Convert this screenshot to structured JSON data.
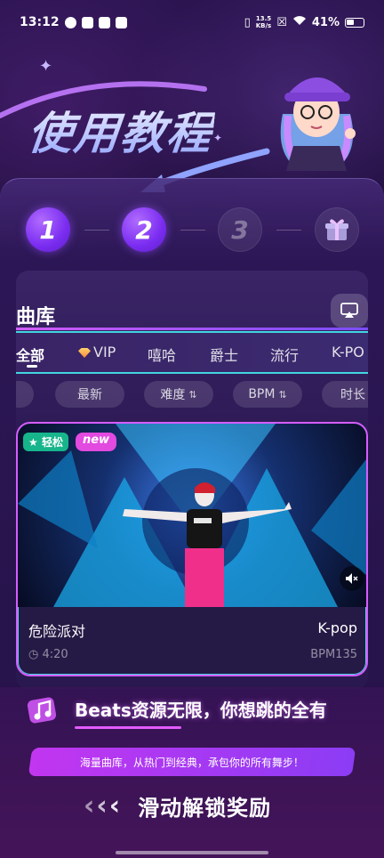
{
  "status_bar": {
    "time": "13:12",
    "net_speed_value": "13.5",
    "net_speed_unit": "KB/s",
    "battery": "41%"
  },
  "header": {
    "title": "使用教程"
  },
  "steps": {
    "items": [
      "1",
      "2",
      "3"
    ],
    "current": 2
  },
  "library": {
    "title": "曲库",
    "tabs": [
      "全部",
      "VIP",
      "嘻哈",
      "爵士",
      "流行",
      "K-PO"
    ],
    "filters": [
      "",
      "最新",
      "难度",
      "BPM",
      "时长"
    ]
  },
  "song": {
    "badge_easy": "轻松",
    "badge_new": "new",
    "name": "危险派对",
    "genre": "K-pop",
    "duration": "4:20",
    "bpm": "BPM135"
  },
  "promo": {
    "headline": "Beats资源无限，你想跳的全有",
    "subtitle": "海量曲库，从热门到经典，承包你的所有舞步！",
    "swipe_label": "滑动解锁奖励"
  },
  "colors": {
    "accent_purple": "#7a2cf0",
    "accent_pink": "#d65cff",
    "accent_cyan": "#41d6e0"
  }
}
